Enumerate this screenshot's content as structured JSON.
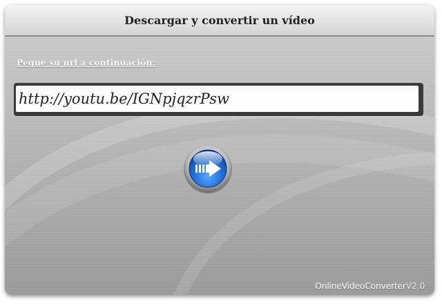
{
  "header": {
    "title": "Descargar y convertir un vídeo"
  },
  "form": {
    "url_label": "Pegue su url a continuación:",
    "url_value": "http://youtu.be/IGNpjqzrPsw",
    "submit_icon": "arrow-right-icon"
  },
  "footer": {
    "brand_name": "OnlineVideoConverter",
    "brand_version": "V2.0"
  },
  "colors": {
    "panel_background": "#b5b5b5",
    "button_blue": "#1f6fd8",
    "label_text": "#ffffff"
  }
}
